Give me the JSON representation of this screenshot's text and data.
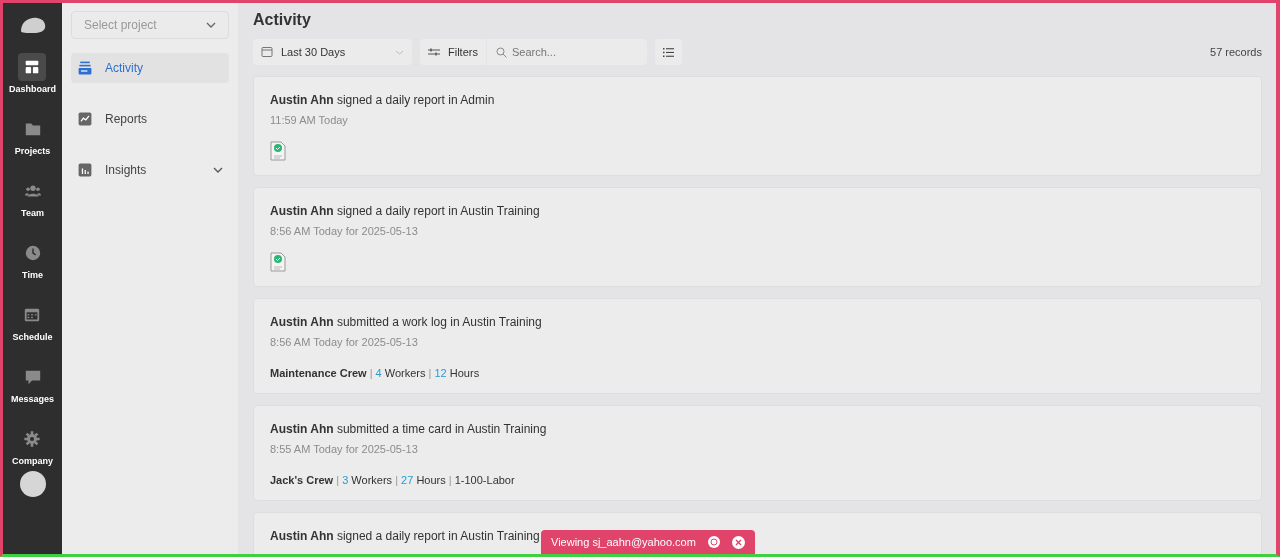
{
  "rail": {
    "items": [
      {
        "label": "Dashboard",
        "selected": true
      },
      {
        "label": "Projects",
        "selected": false
      },
      {
        "label": "Team",
        "selected": false
      },
      {
        "label": "Time",
        "selected": false
      },
      {
        "label": "Schedule",
        "selected": false
      },
      {
        "label": "Messages",
        "selected": false
      },
      {
        "label": "Company",
        "selected": false
      }
    ]
  },
  "sidebar": {
    "project_select": {
      "placeholder": "Select project"
    },
    "items": [
      {
        "label": "Activity",
        "selected": true,
        "expandable": false
      },
      {
        "label": "Reports",
        "selected": false,
        "expandable": false
      },
      {
        "label": "Insights",
        "selected": false,
        "expandable": true
      }
    ]
  },
  "page": {
    "title": "Activity"
  },
  "toolbar": {
    "date_range": "Last 30 Days",
    "filters": "Filters",
    "search": {
      "placeholder": "Search..."
    },
    "record_count": "57 records"
  },
  "activities": [
    {
      "text": "**Austin Ahn** signed a daily report in Admin",
      "meta": "11:59 AM Today",
      "has_pdf": true
    },
    {
      "text": "**Austin Ahn** signed a daily report in Austin Training",
      "meta": "8:56 AM Today for 2025-05-13",
      "has_pdf": true
    },
    {
      "text": "**Austin Ahn** submitted a work log in Austin Training",
      "meta": "8:56 AM Today for 2025-05-13",
      "details": [
        {
          "kind": "name",
          "text": "Maintenance Crew"
        },
        {
          "kind": "sep",
          "text": "|"
        },
        {
          "kind": "number",
          "text": "4"
        },
        {
          "kind": "plain",
          "text": "Workers"
        },
        {
          "kind": "sep",
          "text": "|"
        },
        {
          "kind": "number",
          "text": "12"
        },
        {
          "kind": "plain",
          "text": "Hours"
        }
      ]
    },
    {
      "text": "**Austin Ahn** submitted a time card in Austin Training",
      "meta": "8:55 AM Today for 2025-05-13",
      "details": [
        {
          "kind": "name",
          "text": "Jack's Crew"
        },
        {
          "kind": "sep",
          "text": "|"
        },
        {
          "kind": "number",
          "text": "3"
        },
        {
          "kind": "plain",
          "text": "Workers"
        },
        {
          "kind": "sep",
          "text": "|"
        },
        {
          "kind": "number",
          "text": "27"
        },
        {
          "kind": "plain",
          "text": "Hours"
        },
        {
          "kind": "sep",
          "text": "|"
        },
        {
          "kind": "plain",
          "text": "1-100-Labor"
        }
      ]
    },
    {
      "text": "**Austin Ahn** signed a daily report in Austin Training"
    }
  ],
  "viewing_banner": {
    "text": "Viewing sj_aahn@yahoo.com"
  }
}
